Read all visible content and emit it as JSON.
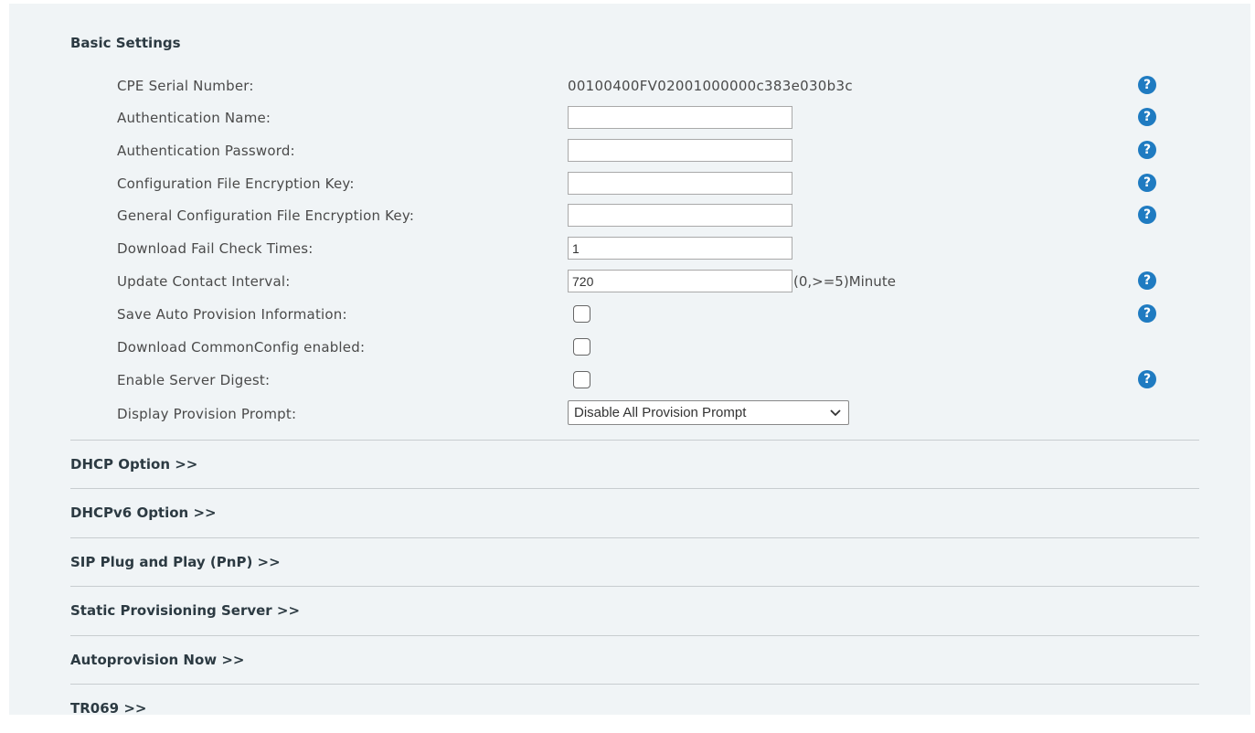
{
  "basic_settings": {
    "title": "Basic Settings",
    "cpe_serial": {
      "label": "CPE Serial Number:",
      "value": "00100400FV02001000000c383e030b3c"
    },
    "auth_name": {
      "label": "Authentication Name:",
      "value": ""
    },
    "auth_password": {
      "label": "Authentication Password:",
      "value": ""
    },
    "config_key": {
      "label": "Configuration File Encryption Key:",
      "value": ""
    },
    "general_config_key": {
      "label": "General Configuration File Encryption Key:",
      "value": ""
    },
    "download_fail": {
      "label": "Download Fail Check Times:",
      "value": "1"
    },
    "update_interval": {
      "label": "Update Contact Interval:",
      "value": "720",
      "unit": "(0,>=5)Minute"
    },
    "save_auto": {
      "label": "Save Auto Provision Information:",
      "checked": false
    },
    "download_common": {
      "label": "Download CommonConfig enabled:",
      "checked": false
    },
    "server_digest": {
      "label": "Enable Server Digest:",
      "checked": false
    },
    "display_prompt": {
      "label": "Display Provision Prompt:",
      "selected": "Disable All Provision Prompt"
    }
  },
  "help_icon": {
    "glyph": "?",
    "color": "#1f7bc1"
  },
  "sections": {
    "dhcp": "DHCP Option >>",
    "dhcpv6": "DHCPv6 Option >>",
    "pnp": "SIP Plug and Play (PnP) >>",
    "static": "Static Provisioning Server >>",
    "autoprovision": "Autoprovision Now >>",
    "tr069": "TR069 >>"
  }
}
